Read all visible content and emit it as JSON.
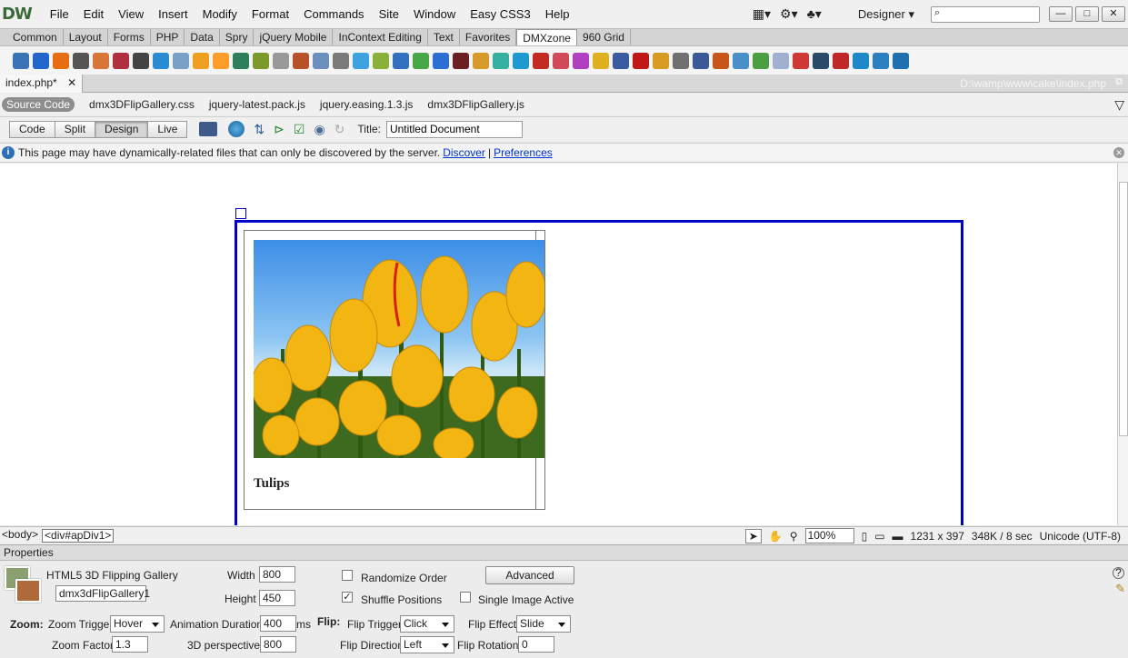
{
  "app": {
    "logo": "DW"
  },
  "menu": [
    "File",
    "Edit",
    "View",
    "Insert",
    "Modify",
    "Format",
    "Commands",
    "Site",
    "Window",
    "Easy CSS3",
    "Help"
  ],
  "workspace": {
    "label": "Designer"
  },
  "insert_categories": [
    "Common",
    "Layout",
    "Forms",
    "PHP",
    "Data",
    "Spry",
    "jQuery Mobile",
    "InContext Editing",
    "Text",
    "Favorites",
    "DMXzone",
    "960 Grid"
  ],
  "active_category": "DMXzone",
  "insert_icons": [
    {
      "name": "image-icon",
      "color": "#3a74b8"
    },
    {
      "name": "media-icon",
      "color": "#2266cc"
    },
    {
      "name": "swirl-icon",
      "color": "#e66d10"
    },
    {
      "name": "gallery-icon",
      "color": "#555555"
    },
    {
      "name": "slideshow-icon",
      "color": "#d9763a"
    },
    {
      "name": "photo-icon",
      "color": "#b03040"
    },
    {
      "name": "video-icon",
      "color": "#444444"
    },
    {
      "name": "stack-icon",
      "color": "#2a8cd2"
    },
    {
      "name": "page-icon",
      "color": "#7aa0c8"
    },
    {
      "name": "note-icon",
      "color": "#f0a020"
    },
    {
      "name": "calendar-icon",
      "color": "#ff9d2a"
    },
    {
      "name": "terminal-icon",
      "color": "#2f7f5a"
    },
    {
      "name": "gear-icon",
      "color": "#7c9a2b"
    },
    {
      "name": "list-icon",
      "color": "#999999"
    },
    {
      "name": "frame-icon",
      "color": "#b8502a"
    },
    {
      "name": "window-icon",
      "color": "#6a8fbf"
    },
    {
      "name": "grid-icon",
      "color": "#7a7a7a"
    },
    {
      "name": "twitter-icon",
      "color": "#3da3e0"
    },
    {
      "name": "bookmark-icon",
      "color": "#8bb03a"
    },
    {
      "name": "chat-icon",
      "color": "#3270c0"
    },
    {
      "name": "chart-icon",
      "color": "#48a848"
    },
    {
      "name": "rss-icon",
      "color": "#2c6ed4"
    },
    {
      "name": "film-icon",
      "color": "#6a2020"
    },
    {
      "name": "slider-icon",
      "color": "#d69a2a"
    },
    {
      "name": "gradient-icon",
      "color": "#35b0a0"
    },
    {
      "name": "play-icon",
      "color": "#1f9ad0"
    },
    {
      "name": "flash-icon",
      "color": "#c22a22"
    },
    {
      "name": "cupcake-icon",
      "color": "#d04a5a"
    },
    {
      "name": "puzzle-icon",
      "color": "#b040c0"
    },
    {
      "name": "pie-icon",
      "color": "#e0b020"
    },
    {
      "name": "network-icon",
      "color": "#3a5ca0"
    },
    {
      "name": "filmstrip-icon",
      "color": "#c01818"
    },
    {
      "name": "flipbook-icon",
      "color": "#d89a20"
    },
    {
      "name": "headphones-icon",
      "color": "#707070"
    },
    {
      "name": "facebook-icon",
      "color": "#3b5998"
    },
    {
      "name": "refresh-icon",
      "color": "#c8561a"
    },
    {
      "name": "sync-icon",
      "color": "#4a90c8"
    },
    {
      "name": "checklist-icon",
      "color": "#4aa040"
    },
    {
      "name": "picture-icon",
      "color": "#a0b0d0"
    },
    {
      "name": "shop-icon",
      "color": "#d03838"
    },
    {
      "name": "code-icon",
      "color": "#2a4a6a"
    },
    {
      "name": "edit-icon",
      "color": "#c02828"
    },
    {
      "name": "fullscreen-icon",
      "color": "#1e88c8"
    },
    {
      "name": "layout-icon",
      "color": "#2a80c0"
    },
    {
      "name": "tiles-icon",
      "color": "#1e70b0"
    }
  ],
  "document": {
    "tab_name": "index.php*",
    "path": "D:\\wamp\\www\\cake\\index.php",
    "related": {
      "source_label": "Source Code",
      "files": [
        "dmx3DFlipGallery.css",
        "jquery-latest.pack.js",
        "jquery.easing.1.3.js",
        "dmx3DFlipGallery.js"
      ]
    },
    "views": [
      "Code",
      "Split",
      "Design",
      "Live"
    ],
    "active_view": "Design",
    "title_label": "Title:",
    "title_value": "Untitled Document"
  },
  "info": {
    "message": "This page may have dynamically-related files that can only be discovered by the server.",
    "discover": "Discover",
    "sep": "|",
    "preferences": "Preferences"
  },
  "canvas": {
    "caption": "Tulips"
  },
  "status": {
    "tags": [
      "<body>",
      "<div#apDiv1>"
    ],
    "zoom": "100%",
    "size": "1231 x 397",
    "weight": "348K / 8 sec",
    "encoding": "Unicode (UTF-8)"
  },
  "properties": {
    "header": "Properties",
    "component": "HTML5 3D Flipping Gallery",
    "id_value": "dmx3dFlipGallery1",
    "width_label": "Width",
    "width_value": "800",
    "height_label": "Height",
    "height_value": "450",
    "randomize_label": "Randomize Order",
    "randomize_checked": false,
    "shuffle_label": "Shuffle Positions",
    "shuffle_checked": true,
    "single_label": "Single Image Active",
    "single_checked": false,
    "advanced_label": "Advanced",
    "zoom_heading": "Zoom:",
    "zoom_trigger_label": "Zoom Trigger",
    "zoom_trigger_value": "Hover",
    "anim_label": "Animation Duration",
    "anim_value": "400",
    "anim_unit": "ms",
    "flip_heading": "Flip:",
    "flip_trigger_label": "Flip Trigger",
    "flip_trigger_value": "Click",
    "flip_effect_label": "Flip Effect",
    "flip_effect_value": "Slide",
    "zoom_factor_label": "Zoom Factor",
    "zoom_factor_value": "1.3",
    "perspective_label": "3D perspective",
    "perspective_value": "800",
    "flip_direction_label": "Flip Direction",
    "flip_direction_value": "Left",
    "flip_rotation_label": "Flip Rotation",
    "flip_rotation_value": "0"
  }
}
